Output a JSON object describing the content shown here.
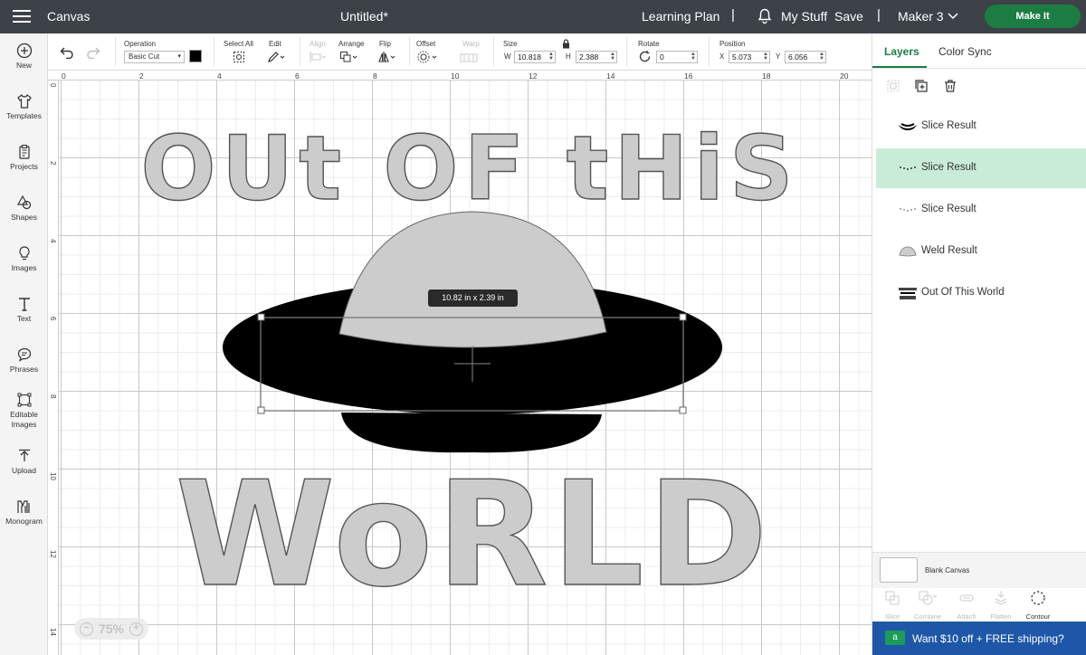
{
  "topbar": {
    "app_title": "Canvas",
    "doc_title": "Untitled*",
    "learning_plan": "Learning Plan",
    "sep1": "|",
    "my_stuff": "My Stuff",
    "save": "Save",
    "sep2": "|",
    "machine": "Maker 3",
    "make_it": "Make It"
  },
  "sidebar": {
    "items": [
      {
        "label": "New"
      },
      {
        "label": "Templates"
      },
      {
        "label": "Projects"
      },
      {
        "label": "Shapes"
      },
      {
        "label": "Images"
      },
      {
        "label": "Text"
      },
      {
        "label": "Phrases"
      },
      {
        "label": "Editable Images"
      },
      {
        "label": "Upload"
      },
      {
        "label": "Monogram"
      }
    ]
  },
  "toolbar": {
    "operation_label": "Operation",
    "operation_value": "Basic Cut",
    "select_all_label": "Select All",
    "edit_label": "Edit",
    "align_label": "Align",
    "arrange_label": "Arrange",
    "flip_label": "Flip",
    "offset_label": "Offset",
    "warp_label": "Warp",
    "size_label": "Size",
    "w_label": "W",
    "w_value": "10.818",
    "h_label": "H",
    "h_value": "2.388",
    "rotate_label": "Rotate",
    "rotate_value": "0",
    "position_label": "Position",
    "x_label": "X",
    "x_value": "5.073",
    "y_label": "Y",
    "y_value": "6.056",
    "operation_color": "#000000"
  },
  "canvas": {
    "ruler_top": [
      "0",
      "2",
      "4",
      "6",
      "8",
      "10",
      "12",
      "14",
      "16",
      "18",
      "20"
    ],
    "ruler_left": [
      "0",
      "2",
      "4",
      "6",
      "8",
      "10",
      "12",
      "14"
    ],
    "title_top": "OUt OF tHiS",
    "title_bottom": "WoRLD",
    "dimension_badge": "10.82  in x 2.39  in",
    "zoom": "75%",
    "zoom_minus": "−",
    "zoom_plus": "+"
  },
  "panel": {
    "tabs": [
      {
        "label": "Layers"
      },
      {
        "label": "Color Sync"
      }
    ],
    "layers": [
      {
        "label": "Slice Result"
      },
      {
        "label": "Slice Result"
      },
      {
        "label": "Slice Result"
      },
      {
        "label": "Weld Result"
      },
      {
        "label": "Out Of This World"
      }
    ],
    "blank_canvas": "Blank Canvas",
    "tools": [
      {
        "label": "Slice"
      },
      {
        "label": "Combine"
      },
      {
        "label": "Attach"
      },
      {
        "label": "Flatten"
      },
      {
        "label": "Contour"
      }
    ],
    "promo": "Want $10 off + FREE shipping?",
    "promo_icon": "a"
  },
  "colors": {
    "topbar": "#3d4148",
    "accent": "#1c7c43",
    "selected_layer": "#c9ecd9",
    "promo": "#1e57a8",
    "shape_fill": "#cccccc"
  }
}
